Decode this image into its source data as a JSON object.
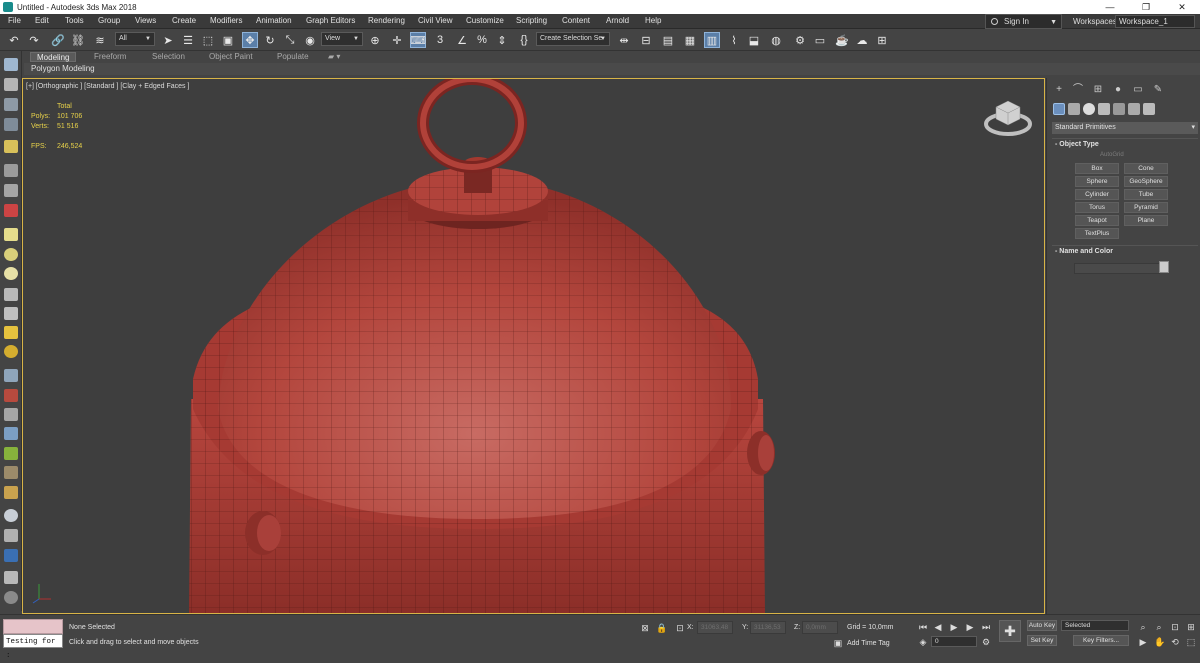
{
  "window": {
    "title": "Untitled - Autodesk 3ds Max 2018",
    "minimize": "—",
    "restore": "❐",
    "close": "✕"
  },
  "menu": {
    "items": [
      "File",
      "Edit",
      "Tools",
      "Group",
      "Views",
      "Create",
      "Modifiers",
      "Animation",
      "Graph Editors",
      "Rendering",
      "Civil View",
      "Customize",
      "Scripting",
      "Content",
      "Arnold",
      "Help"
    ],
    "signin": "Sign In",
    "workspaces_label": "Workspaces:",
    "workspace_value": "Workspace_1"
  },
  "toolbar": {
    "selection_filter": "All",
    "reference_coord": "View",
    "named_selection": "Create Selection Se"
  },
  "ribbon": {
    "tabs": [
      "Modeling",
      "Freeform",
      "Selection",
      "Object Paint",
      "Populate"
    ],
    "active_tab": "Modeling",
    "panel_label": "Polygon Modeling"
  },
  "viewport": {
    "label": "[+] [Orthographic ] [Standard ] [Clay + Edged Faces ]",
    "stats": {
      "total_label": "Total",
      "polys_label": "Polys:",
      "polys_value": "101 706",
      "verts_label": "Verts:",
      "verts_value": "51 516",
      "fps_label": "FPS:",
      "fps_value": "246,524"
    },
    "model_color": "#b8413a"
  },
  "command_panel": {
    "category": "Standard Primitives",
    "object_type_title": "Object Type",
    "autogrid": "AutoGrid",
    "buttons": [
      "Box",
      "Cone",
      "Sphere",
      "GeoSphere",
      "Cylinder",
      "Tube",
      "Torus",
      "Pyramid",
      "Teapot",
      "Plane",
      "TextPlus"
    ],
    "name_color_title": "Name and Color"
  },
  "status": {
    "maxscript": "Testing for :",
    "selection": "None Selected",
    "prompt": "Click and drag to select and move objects",
    "x_label": "X:",
    "x_value": "31063,48",
    "y_label": "Y:",
    "y_value": "31136,53",
    "z_label": "Z:",
    "z_value": "0,0mm",
    "grid": "Grid = 10,0mm",
    "add_time_tag": "Add Time Tag",
    "auto_key": "Auto Key",
    "selected_value": "Selected",
    "set_key": "Set Key",
    "key_filters": "Key Filters...",
    "frame_value": "0"
  }
}
